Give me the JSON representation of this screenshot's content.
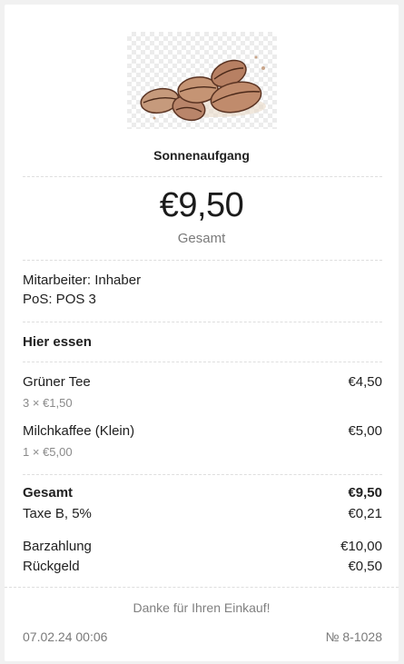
{
  "shop": {
    "name": "Sonnenaufgang",
    "logo_icon": "coffee-beans-icon"
  },
  "summary": {
    "total": "€9,50",
    "total_caption": "Gesamt"
  },
  "meta": {
    "employee": "Mitarbeiter: Inhaber",
    "pos": "PoS: POS 3"
  },
  "order_type": "Hier essen",
  "items": [
    {
      "name": "Grüner Tee",
      "detail": "3 × €1,50",
      "price": "€4,50"
    },
    {
      "name": "Milchkaffee (Klein)",
      "detail": "1 × €5,00",
      "price": "€5,00"
    }
  ],
  "totals": {
    "total_label": "Gesamt",
    "total_value": "€9,50",
    "tax_label": "Taxe B, 5%",
    "tax_value": "€0,21"
  },
  "payment": {
    "method_label": "Barzahlung",
    "method_value": "€10,00",
    "change_label": "Rückgeld",
    "change_value": "€0,50"
  },
  "footer": {
    "thanks": "Danke für Ihren Einkauf!",
    "datetime": "07.02.24 00:06",
    "receipt_no": "№ 8-1028"
  }
}
